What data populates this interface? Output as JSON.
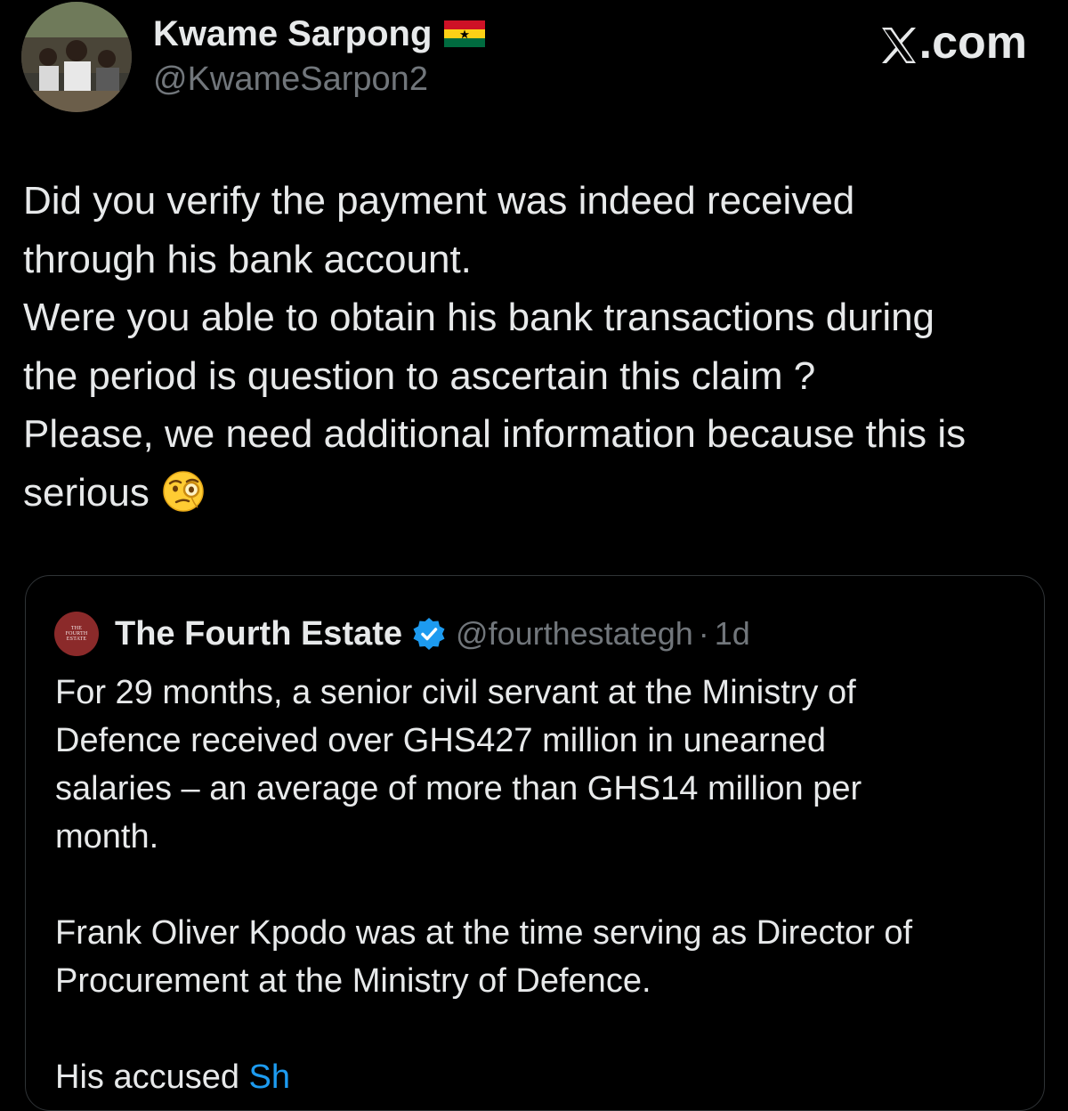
{
  "author": {
    "display_name": "Kwame Sarpong",
    "handle": "@KwameSarpon2",
    "flag_icon": "ghana-flag-icon"
  },
  "brand": {
    "text": ".com",
    "icon": "x-logo-icon"
  },
  "tweet": {
    "lines": [
      "Did you verify the payment was indeed received",
      "through his bank account.",
      "Were you able to obtain his bank transactions during",
      "the period is question to ascertain this claim ?",
      "Please, we need additional information because this is",
      "serious"
    ],
    "emoji": "face-with-monocle-emoji"
  },
  "quoted_tweet": {
    "avatar_text": [
      "THE",
      "FOURTH",
      "ESTATE"
    ],
    "display_name": "The Fourth Estate",
    "handle": "@fourthestategh",
    "separator": "·",
    "time": "1d",
    "verified_icon": "verified-badge-icon",
    "paragraph1": [
      "For 29 months, a senior civil servant at the Ministry of",
      "Defence received over GHS427 million in unearned",
      "salaries – an average of more than GHS14 million per",
      "month."
    ],
    "paragraph2": [
      "Frank Oliver Kpodo was at the time serving as Director of",
      "Procurement at the Ministry of Defence."
    ],
    "partial_line_text": "His accused",
    "partial_line_link": "Sh"
  },
  "colors": {
    "background": "#000000",
    "text_primary": "#e7e9ea",
    "text_secondary": "#71767b",
    "border": "#2f3336",
    "link": "#1d9bf0",
    "verified": "#1d9bf0"
  }
}
